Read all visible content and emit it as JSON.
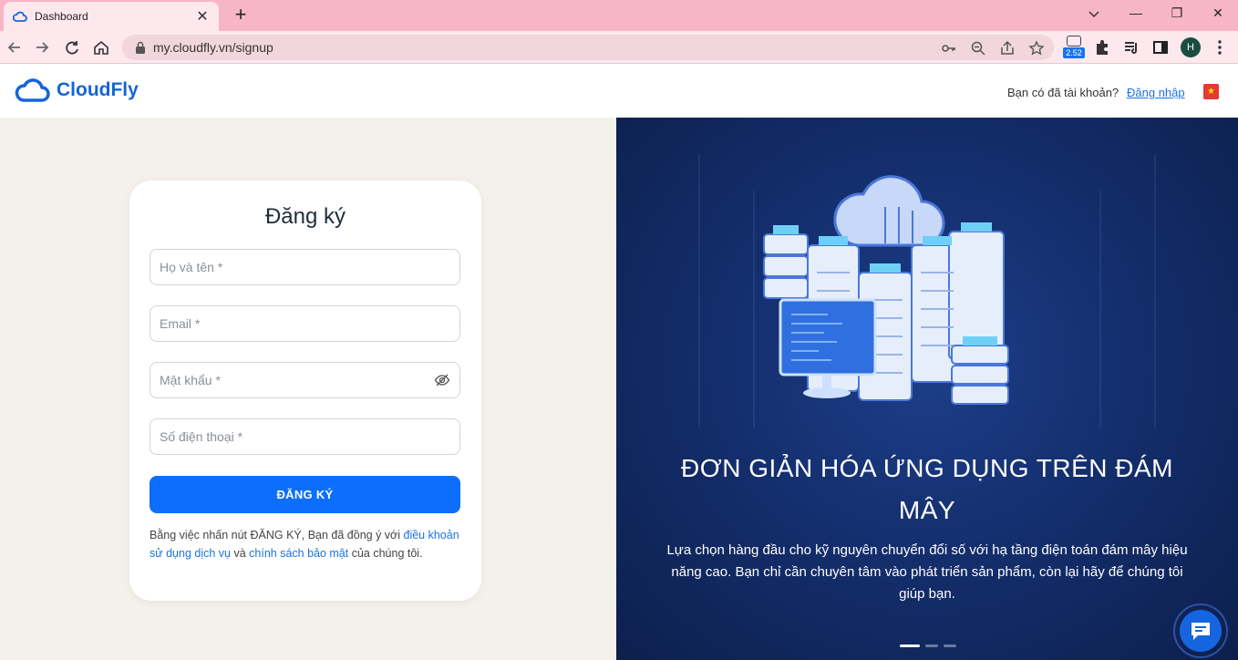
{
  "browser": {
    "tab_title": "Dashboard",
    "tab_close": "✕",
    "new_tab": "+",
    "url": "my.cloudfly.vn/signup",
    "extension_badge": "2.52",
    "profile_initial": "H",
    "window_controls": {
      "minimize": "—",
      "maximize": "❐",
      "close": "✕"
    }
  },
  "header": {
    "brand": "CloudFly",
    "account_question": "Bạn có đã tài khoản?",
    "login_link": "Đăng nhập",
    "flag_icon": "vietnam-flag-icon"
  },
  "form": {
    "title": "Đăng ký",
    "fullname_placeholder": "Họ và tên *",
    "email_placeholder": "Email *",
    "password_placeholder": "Mật khẩu *",
    "phone_placeholder": "Số điện thoại *",
    "submit_label": "ĐĂNG KÝ",
    "terms_prefix": "Bằng việc nhấn nút ĐĂNG KÝ, Bạn đã đồng ý với ",
    "terms_link": "điều khoản sử dụng dịch vụ",
    "terms_middle": " và ",
    "privacy_link": "chính sách bảo mật",
    "terms_suffix": " của chúng tôi."
  },
  "hero": {
    "title": "ĐƠN GIẢN HÓA ỨNG DỤNG TRÊN ĐÁM MÂY",
    "description": "Lựa chọn hàng đầu cho kỹ nguyên chuyển đổi số với hạ tầng điện toán đám mây hiệu năng cao. Bạn chỉ cần chuyên tâm vào phát triển sản phẩm, còn lại hãy để chúng tôi giúp bạn.",
    "slides_total": 3,
    "slide_active": 1
  },
  "colors": {
    "brand": "#1565d8",
    "button": "#0d6efd",
    "left_bg": "#f4f1ea",
    "hero_bg": "#142f6e",
    "tab_strip": "#f7b6c6"
  }
}
